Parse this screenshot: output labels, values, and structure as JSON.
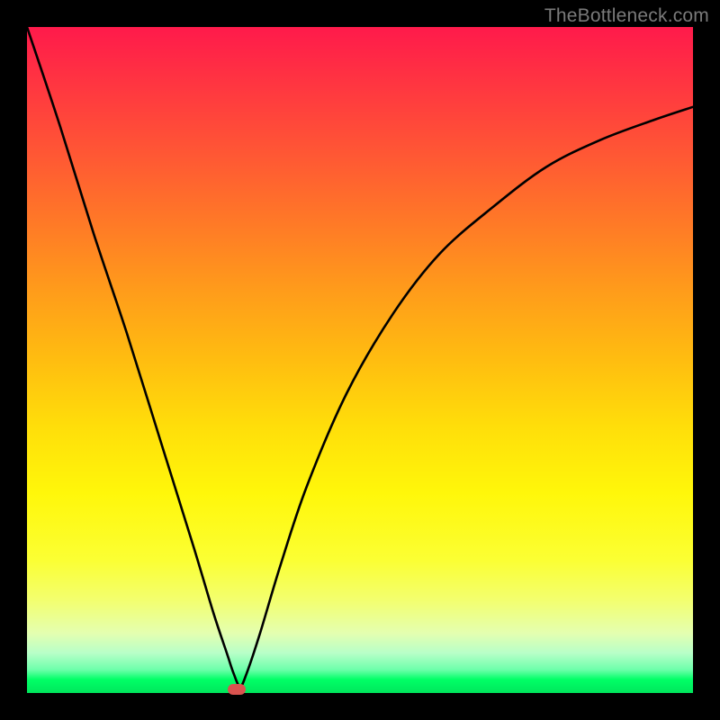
{
  "watermark": "TheBottleneck.com",
  "chart_data": {
    "type": "line",
    "title": "",
    "xlabel": "",
    "ylabel": "",
    "xlim": [
      0,
      100
    ],
    "ylim": [
      0,
      100
    ],
    "grid": false,
    "legend": false,
    "series": [
      {
        "name": "bottleneck-curve",
        "x": [
          0,
          5,
          10,
          15,
          20,
          25,
          28,
          30,
          31,
          32,
          33,
          35,
          38,
          42,
          48,
          55,
          62,
          70,
          78,
          86,
          94,
          100
        ],
        "y": [
          100,
          85,
          69,
          54,
          38,
          22,
          12,
          6,
          3,
          1,
          3,
          9,
          19,
          31,
          45,
          57,
          66,
          73,
          79,
          83,
          86,
          88
        ]
      }
    ],
    "marker": {
      "x": 31.5,
      "y": 0.5,
      "color": "#d9534f"
    },
    "background_gradient": {
      "top": "#ff1a4b",
      "mid": "#ffde0a",
      "bottom": "#00e65c"
    }
  }
}
